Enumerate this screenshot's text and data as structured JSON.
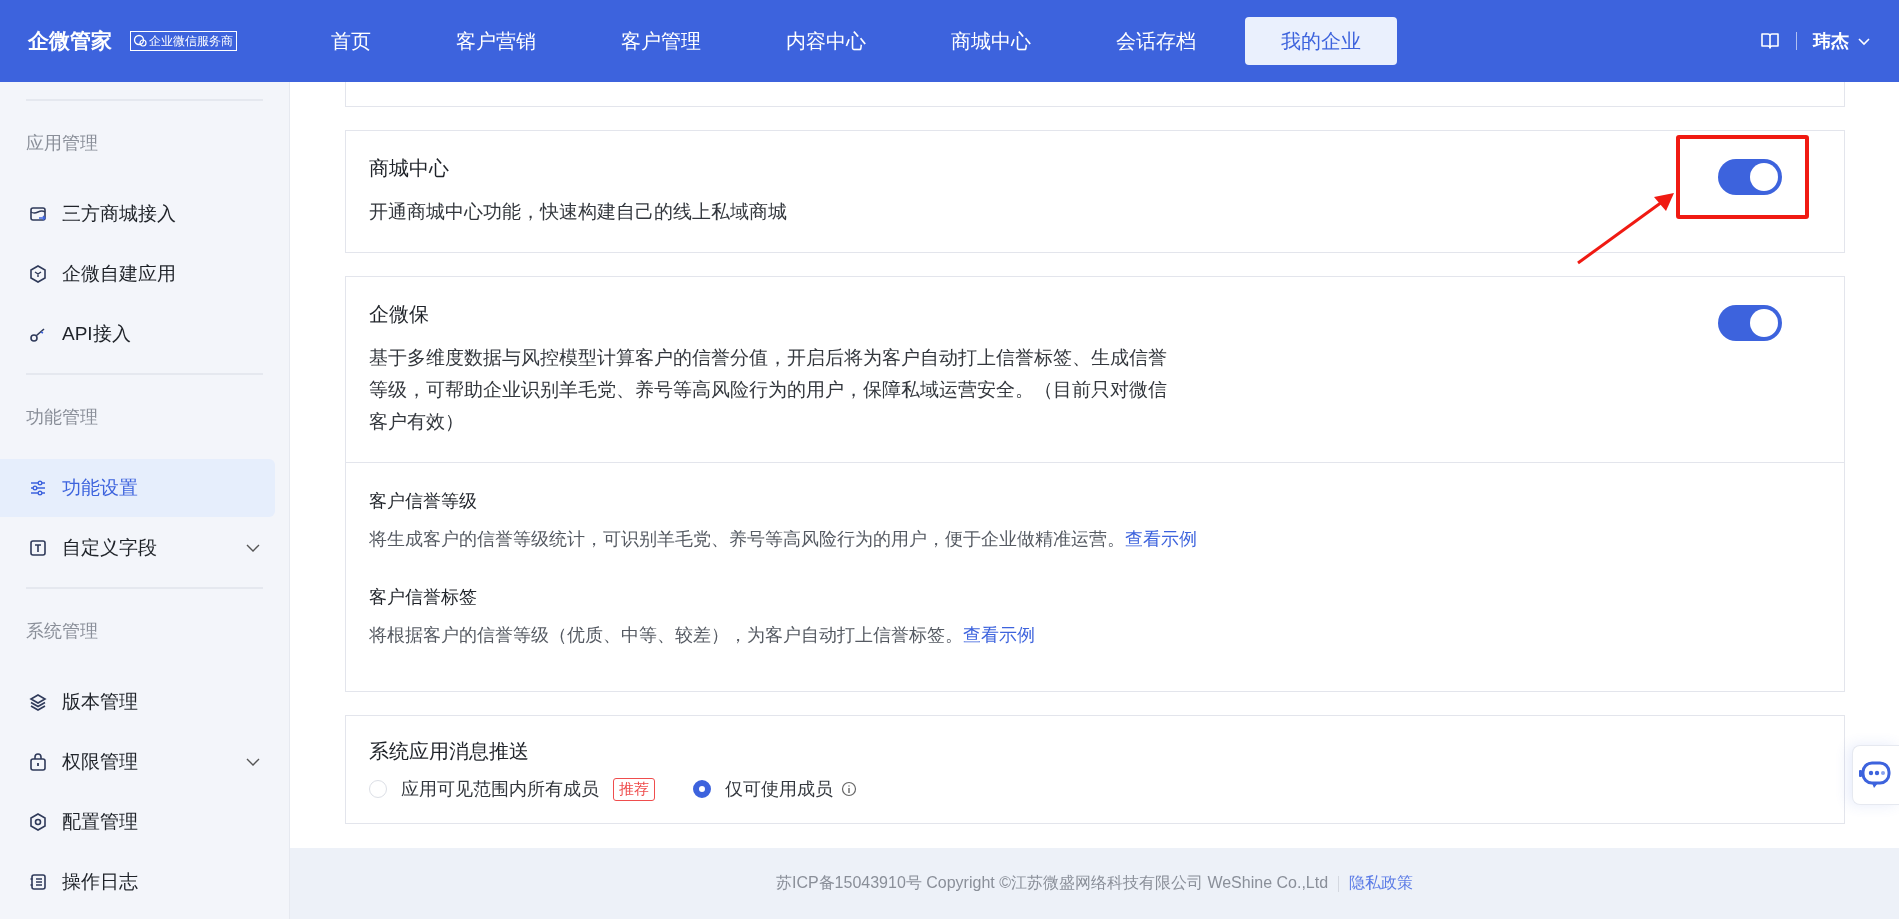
{
  "header": {
    "logo": "企微管家",
    "badge": "企业微信服务商",
    "nav": [
      {
        "label": "首页",
        "selected": false
      },
      {
        "label": "客户营销",
        "selected": false
      },
      {
        "label": "客户管理",
        "selected": false
      },
      {
        "label": "内容中心",
        "selected": false
      },
      {
        "label": "商城中心",
        "selected": false
      },
      {
        "label": "会话存档",
        "selected": false
      },
      {
        "label": "我的企业",
        "selected": true
      }
    ],
    "user": "玮杰"
  },
  "sidebar": {
    "groups": [
      {
        "title": "应用管理",
        "items": [
          {
            "label": "三方商城接入",
            "kind": "link",
            "selected": false
          },
          {
            "label": "企微自建应用",
            "kind": "link",
            "selected": false
          },
          {
            "label": "API接入",
            "kind": "link",
            "selected": false
          }
        ]
      },
      {
        "title": "功能管理",
        "items": [
          {
            "label": "功能设置",
            "kind": "link",
            "selected": true
          },
          {
            "label": "自定义字段",
            "kind": "submenu",
            "selected": false
          }
        ]
      },
      {
        "title": "系统管理",
        "items": [
          {
            "label": "版本管理",
            "kind": "link",
            "selected": false
          },
          {
            "label": "权限管理",
            "kind": "submenu",
            "selected": false
          },
          {
            "label": "配置管理",
            "kind": "link",
            "selected": false
          },
          {
            "label": "操作日志",
            "kind": "link",
            "selected": false
          }
        ]
      }
    ]
  },
  "settings": [
    {
      "kind": "toggle",
      "title": "商城中心",
      "description": "开通商城中心功能，快速构建自己的线上私域商城",
      "on": true,
      "highlighted": true
    },
    {
      "kind": "toggle",
      "title": "企微保",
      "description": "基于多维度数据与风控模型计算客户的信誉分值，开启后将为客户自动打上信誉标签、生成信誉等级，可帮助企业识别羊毛党、养号等高风险行为的用户，保障私域运营安全。（目前只对微信客户有效）",
      "on": true,
      "highlighted": false,
      "sub_items": [
        {
          "title": "客户信誉等级",
          "description": "将生成客户的信誉等级统计，可识别羊毛党、养号等高风险行为的用户，便于企业做精准运营。",
          "link": "查看示例"
        },
        {
          "title": "客户信誉标签",
          "description": "将根据客户的信誉等级（优质、中等、较差），为客户自动打上信誉标签。",
          "link": "查看示例"
        }
      ]
    },
    {
      "kind": "radio",
      "title": "系统应用消息推送",
      "highlighted": false,
      "options": [
        {
          "label": "应用可见范围内所有成员",
          "selected": false,
          "badge": "推荐",
          "info": false
        },
        {
          "label": "仅可使用成员",
          "selected": true,
          "info": true
        }
      ]
    }
  ],
  "footer": {
    "text": "苏ICP备15043910号 Copyright ©江苏微盛网络科技有限公司 WeShine Co.,Ltd",
    "link": "隐私政策"
  }
}
